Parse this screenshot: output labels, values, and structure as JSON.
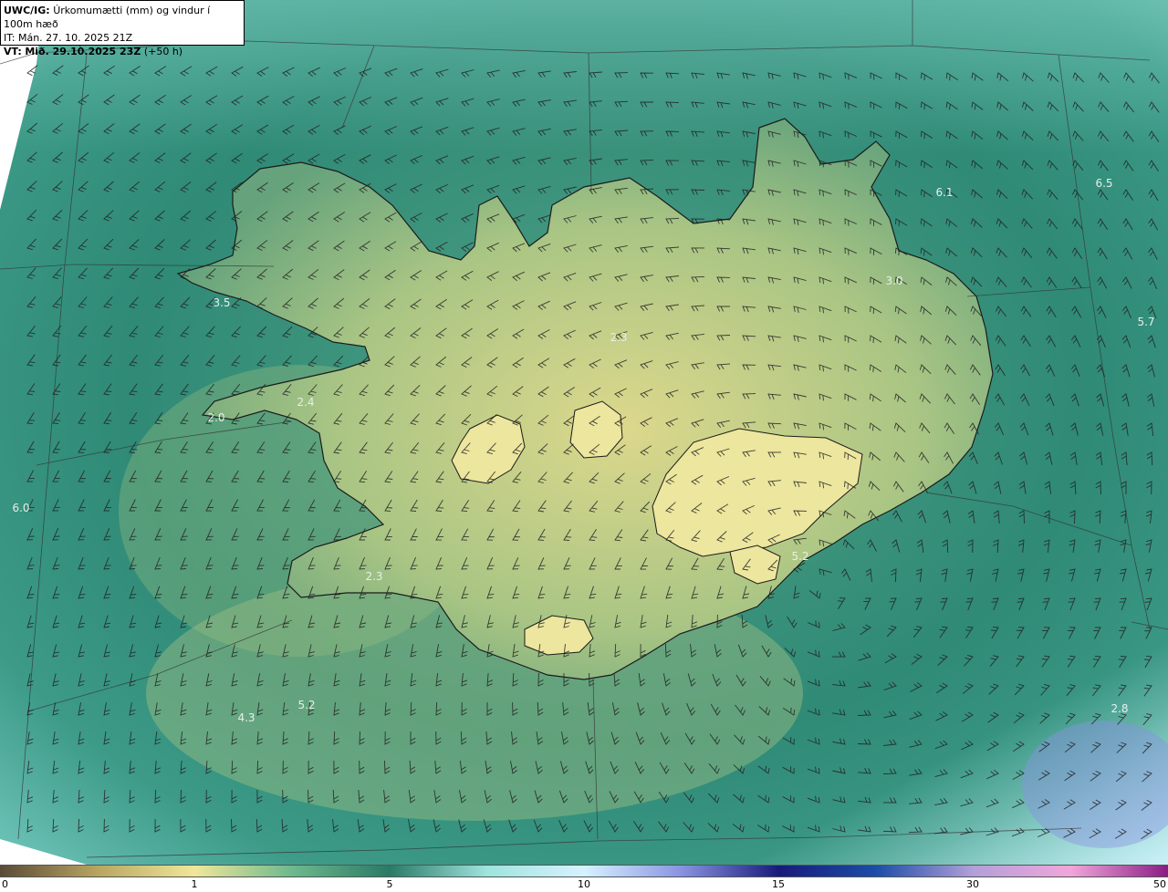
{
  "header": {
    "model": "UWC/IG:",
    "description": "Úrkomumætti (mm) og vindur í 100m hæð",
    "it_line": "IT: Mán. 27. 10. 2025 21Z",
    "vt_prefix": "VT:",
    "vt_time": "Mið. 29.10.2025 23Z",
    "vt_offset": "(+50 h)"
  },
  "colorbar": {
    "ticks": [
      "0",
      "1",
      "5",
      "10",
      "15",
      "30",
      "50"
    ],
    "colors": [
      "#5b4a38",
      "#b8a560",
      "#f0e79a",
      "#6eb98d",
      "#2a7a66",
      "#9fe3dd",
      "#d7f2ff",
      "#8a93e2",
      "#191a7a",
      "#1c4da8",
      "#b39fd9",
      "#f1a6da",
      "#8a1c85"
    ]
  },
  "value_labels": [
    "6.1",
    "6.5",
    "3.0",
    "3.5",
    "5.7",
    "2.3",
    "2.4",
    "2.0",
    "6.0",
    "5.2",
    "2.3",
    "5.2",
    "4.3",
    "2.8"
  ],
  "colors": {
    "sea": "#2f8a76",
    "coast": "#1b1b1b",
    "land_low": "#7fb07d",
    "land_high": "#e2dd8c",
    "ice": "#e8e49b"
  }
}
